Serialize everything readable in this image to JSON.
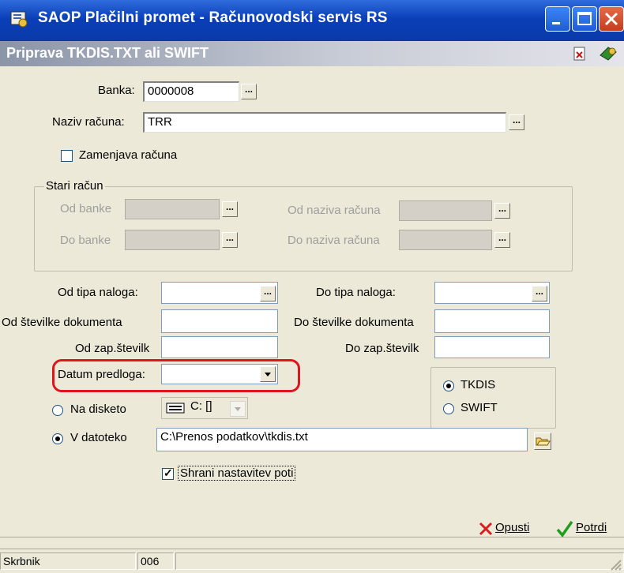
{
  "window": {
    "title": "SAOP Plačilni promet - Računovodski servis RS",
    "subtitle": "Priprava TKDIS.TXT ali SWIFT"
  },
  "form": {
    "banka_label": "Banka:",
    "banka_value": "0000008",
    "naziv_label": "Naziv računa:",
    "naziv_value": "TRR",
    "zamenjava_label": "Zamenjava računa",
    "ellipsis": "...",
    "stari_racun": {
      "title": "Stari račun",
      "od_banke": "Od banke",
      "do_banke": "Do banke",
      "od_naziva": "Od naziva računa",
      "do_naziva": "Do naziva računa"
    },
    "od_tipa_label": "Od tipa naloga:",
    "do_tipa_label": "Do tipa naloga:",
    "od_stevilke_label": "Od številke dokumenta",
    "do_stevilke_label": "Do številke dokumenta",
    "od_zap_label": "Od zap.številk",
    "do_zap_label": "Do zap.številk",
    "datum_label": "Datum predloga:",
    "format": {
      "tkdis": "TKDIS",
      "swift": "SWIFT",
      "selected": "TKDIS"
    },
    "na_disketo_label": "Na disketo",
    "drive_value": "C: []",
    "v_datoteko_label": "V datoteko",
    "file_path": "C:\\Prenos podatkov\\tkdis.txt",
    "shrani_label": "Shrani nastavitev poti"
  },
  "footer": {
    "opusti_label": "Opusti",
    "potrdi_label": "Potrdi"
  },
  "status": {
    "user": "Skrbnik",
    "code": "006"
  },
  "colors": {
    "title_blue": "#0A3FB8",
    "highlight_red": "#E0141B",
    "cancel_red": "#D71D1D",
    "ok_green": "#1E9E1E"
  }
}
